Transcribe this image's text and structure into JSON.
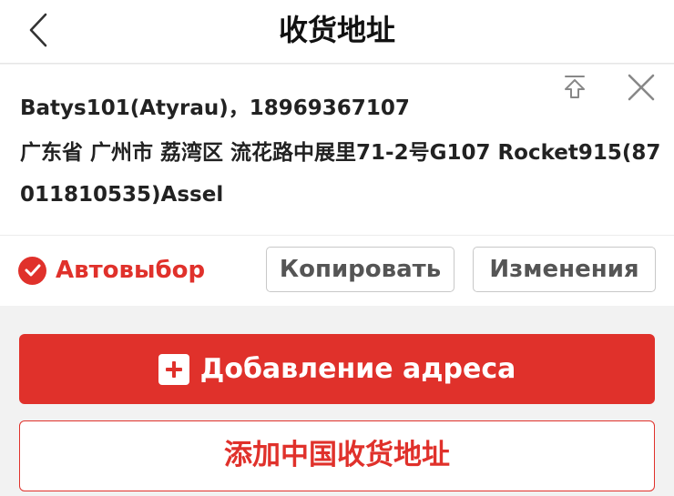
{
  "header": {
    "title": "收货地址",
    "back_icon": "chevron-left-icon"
  },
  "address_card": {
    "contact": "Batys101(Atyrau)，18969367107",
    "address": "广东省 广州市 荔湾区 流花路中展里71-2号G107 Rocket915(87011810535)Assel",
    "pin_top_icon": "pin-to-top-icon",
    "close_icon": "close-icon"
  },
  "actions": {
    "auto_select_label": "Автовыбор",
    "copy_label": "Копировать",
    "edit_label": "Изменения"
  },
  "bottom": {
    "add_address_label": "Добавление адреса",
    "add_china_address_label": "添加中国收货地址"
  },
  "colors": {
    "accent": "#e0312b",
    "background": "#f2f2f2",
    "card": "#ffffff"
  }
}
